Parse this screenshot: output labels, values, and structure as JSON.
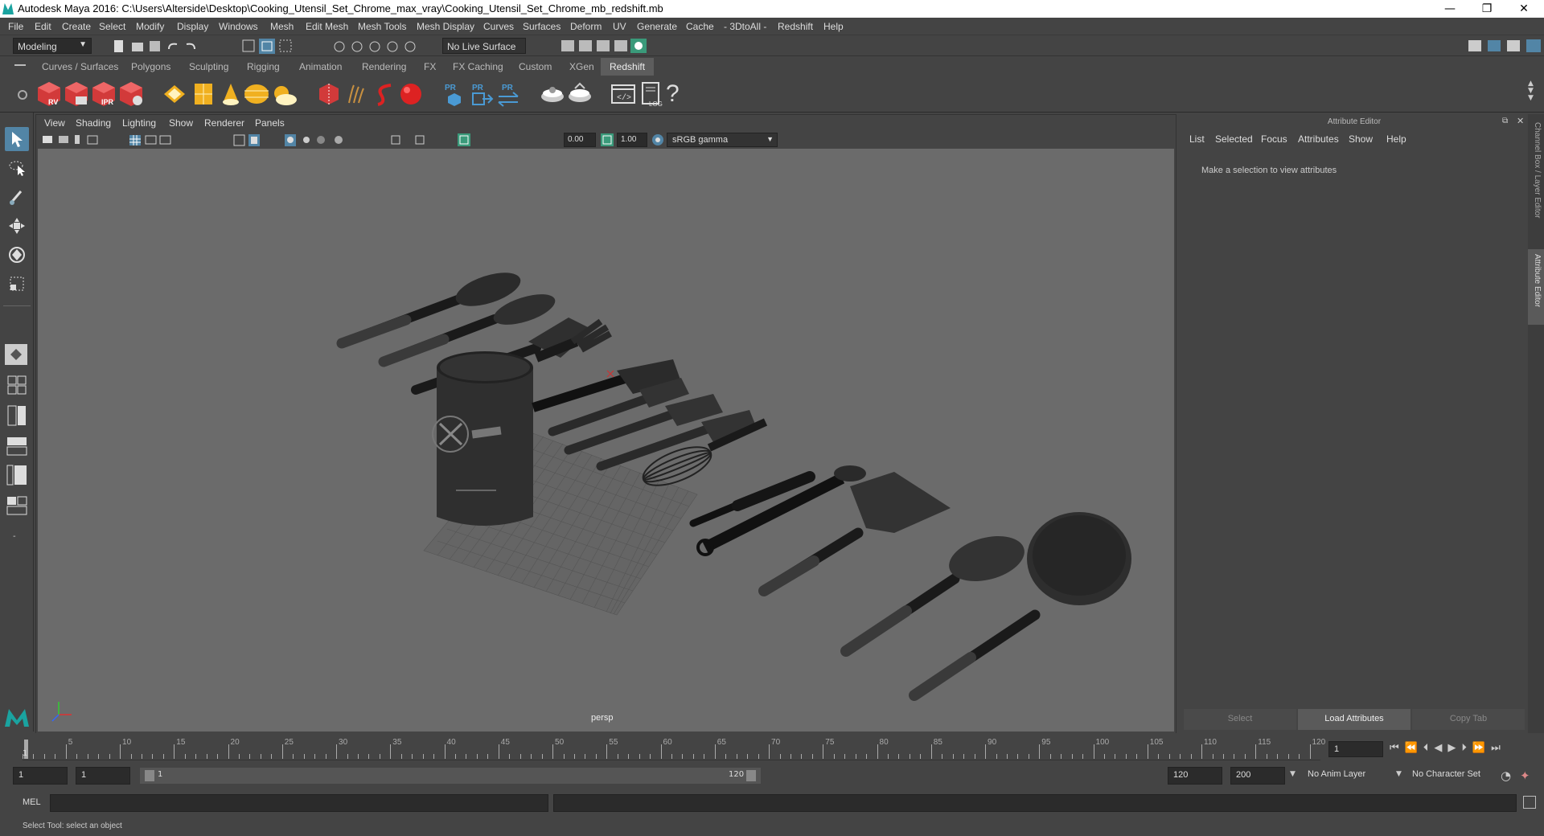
{
  "window": {
    "title": "Autodesk Maya 2016: C:\\Users\\Alterside\\Desktop\\Cooking_Utensil_Set_Chrome_max_vray\\Cooking_Utensil_Set_Chrome_mb_redshift.mb",
    "minimize": "—",
    "maximize": "❐",
    "close": "✕"
  },
  "menubar": [
    "File",
    "Edit",
    "Create",
    "Select",
    "Modify",
    "Display",
    "Windows",
    "Mesh",
    "Edit Mesh",
    "Mesh Tools",
    "Mesh Display",
    "Curves",
    "Surfaces",
    "Deform",
    "UV",
    "Generate",
    "Cache",
    "- 3DtoAll -",
    "Redshift",
    "Help"
  ],
  "statusline": {
    "mode": "Modeling",
    "live_surface": "No Live Surface"
  },
  "shelf_tabs": [
    "Curves / Surfaces",
    "Polygons",
    "Sculpting",
    "Rigging",
    "Animation",
    "Rendering",
    "FX",
    "FX Caching",
    "Custom",
    "XGen",
    "Redshift"
  ],
  "shelf_active": "Redshift",
  "shelf_icon_labels": {
    "rv": "RV",
    "ipr": "IPR",
    "pr": "PR",
    "log": "LOG",
    "help": "?"
  },
  "viewport": {
    "menu": [
      "View",
      "Shading",
      "Lighting",
      "Show",
      "Renderer",
      "Panels"
    ],
    "exposure": "0.00",
    "gamma": "1.00",
    "color_space": "sRGB gamma",
    "camera_label": "persp"
  },
  "attribute_editor": {
    "title": "Attribute Editor",
    "menu": [
      "List",
      "Selected",
      "Focus",
      "Attributes",
      "Show",
      "Help"
    ],
    "message": "Make a selection to view attributes",
    "buttons": {
      "select": "Select",
      "load": "Load Attributes",
      "copy": "Copy Tab"
    },
    "side_tabs": [
      "Channel Box / Layer Editor",
      "Attribute Editor"
    ]
  },
  "timeline": {
    "ticks": [
      "5",
      "10",
      "15",
      "20",
      "25",
      "30",
      "35",
      "40",
      "45",
      "50",
      "55",
      "60",
      "65",
      "70",
      "75",
      "80",
      "85",
      "90",
      "95",
      "100",
      "105",
      "110",
      "115",
      "120"
    ],
    "start_marker": "1",
    "current_frame": "1"
  },
  "range": {
    "start": "1",
    "anim_start": "1",
    "slider_start": "1",
    "slider_end": "120",
    "anim_end": "120",
    "end": "200",
    "anim_layer": "No Anim Layer",
    "character_set": "No Character Set"
  },
  "cmdline": {
    "label": "MEL"
  },
  "helpline": {
    "text": "Select Tool: select an object"
  },
  "colors": {
    "accent": "#5285a6",
    "redshift_red": "#d23a3a",
    "viewport_bg": "#6b6b6b",
    "maya_teal": "#1aa3a0"
  }
}
